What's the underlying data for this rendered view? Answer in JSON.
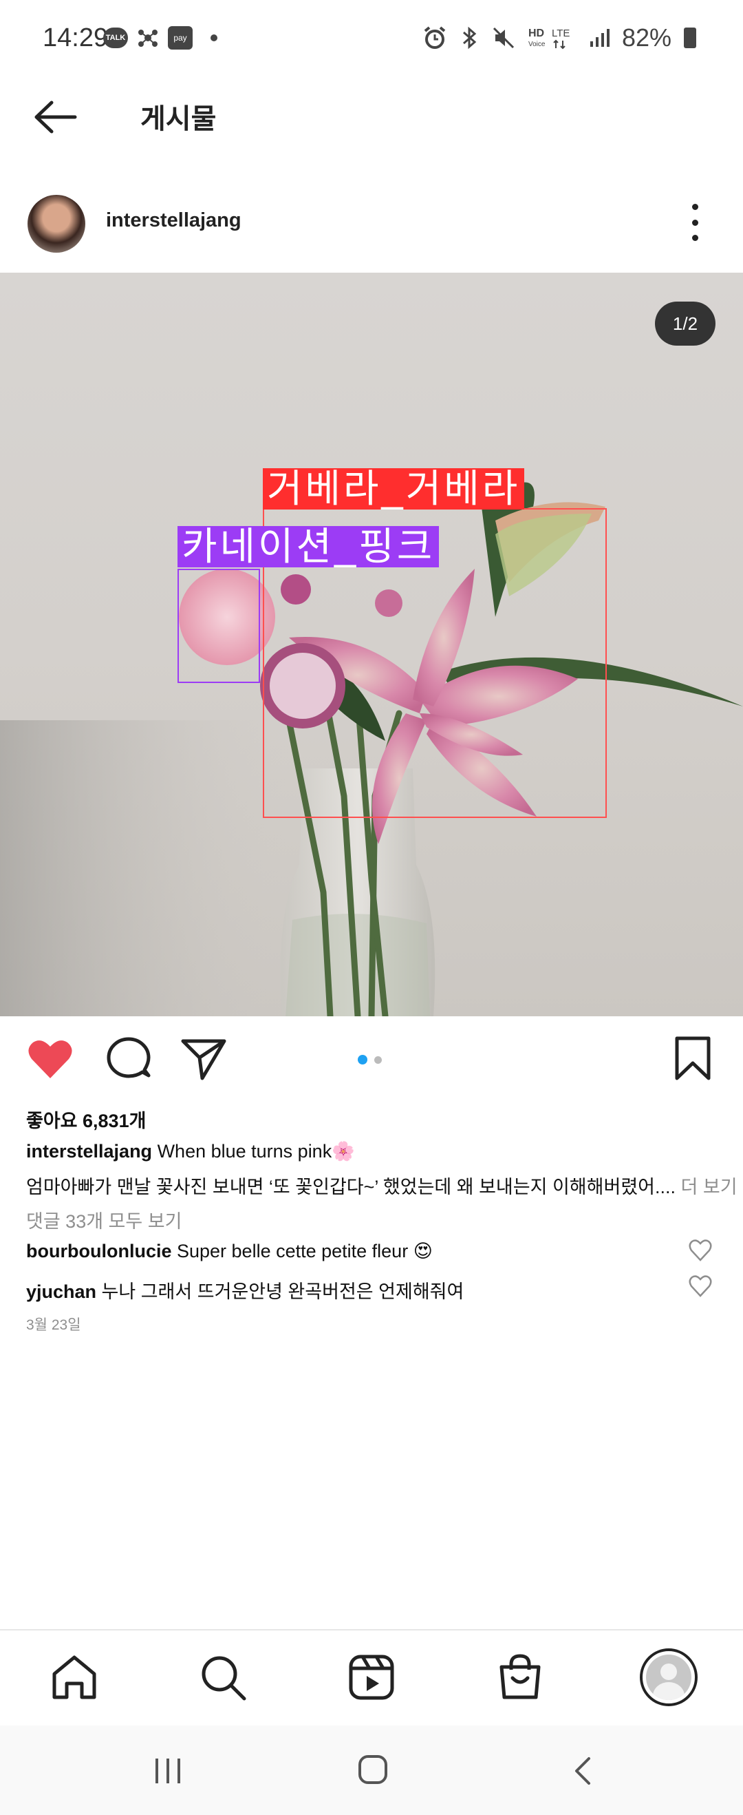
{
  "status_bar": {
    "time": "14:29",
    "left_icons": [
      "talk-icon",
      "network-icon",
      "pay-icon",
      "dot-icon"
    ],
    "talk_label": "TALK",
    "pay_label": "pay",
    "right_icons": [
      "alarm-icon",
      "bluetooth-icon",
      "mute-icon",
      "hd-lte-icon",
      "signal-icon",
      "battery-icon"
    ],
    "hd_label": "HD",
    "voice_label": "Voice",
    "lte_label": "LTE",
    "battery": "82%"
  },
  "header": {
    "back_icon": "arrow-left-icon",
    "title": "게시물"
  },
  "post": {
    "username": "interstellajang",
    "menu_icon": "more-vertical-icon",
    "photo": {
      "counter": "1/2",
      "labels": [
        "거베라_거베라",
        "카네이션_핑크"
      ],
      "label_colors": [
        "#ff2e2e",
        "#9c3cf5"
      ]
    },
    "actions": {
      "like_icon": "heart-filled-icon",
      "comment_icon": "comment-icon",
      "share_icon": "send-icon",
      "save_icon": "bookmark-icon",
      "like_color": "#ed4956",
      "active_dot_color": "#1ea1f2"
    },
    "likes": "좋아요 6,831개",
    "caption": {
      "username": "interstellajang",
      "text": " When blue turns pink🌸",
      "line2": "엄마아빠가 맨날 꽃사진 보내면 ‘또 꽃인갑다~’ 했었는데 왜 보내는지 이해해버렸어....",
      "more": " 더 보기"
    },
    "view_all_comments": "댓글 33개 모두 보기",
    "comments": [
      {
        "username": "bourboulonlucie",
        "text": " Super belle cette petite fleur 😍"
      },
      {
        "username": "yjuchan",
        "text": " 누나 그래서 뜨거운안녕 완곡버전은 언제해줘여"
      }
    ],
    "date": "3월 23일"
  },
  "bottom_nav": {
    "items": [
      "home-icon",
      "search-icon",
      "reels-icon",
      "shop-icon",
      "profile-avatar"
    ]
  },
  "system_nav": {
    "items": [
      "recent-apps-icon",
      "home-circle-icon",
      "back-chevron-icon"
    ]
  }
}
